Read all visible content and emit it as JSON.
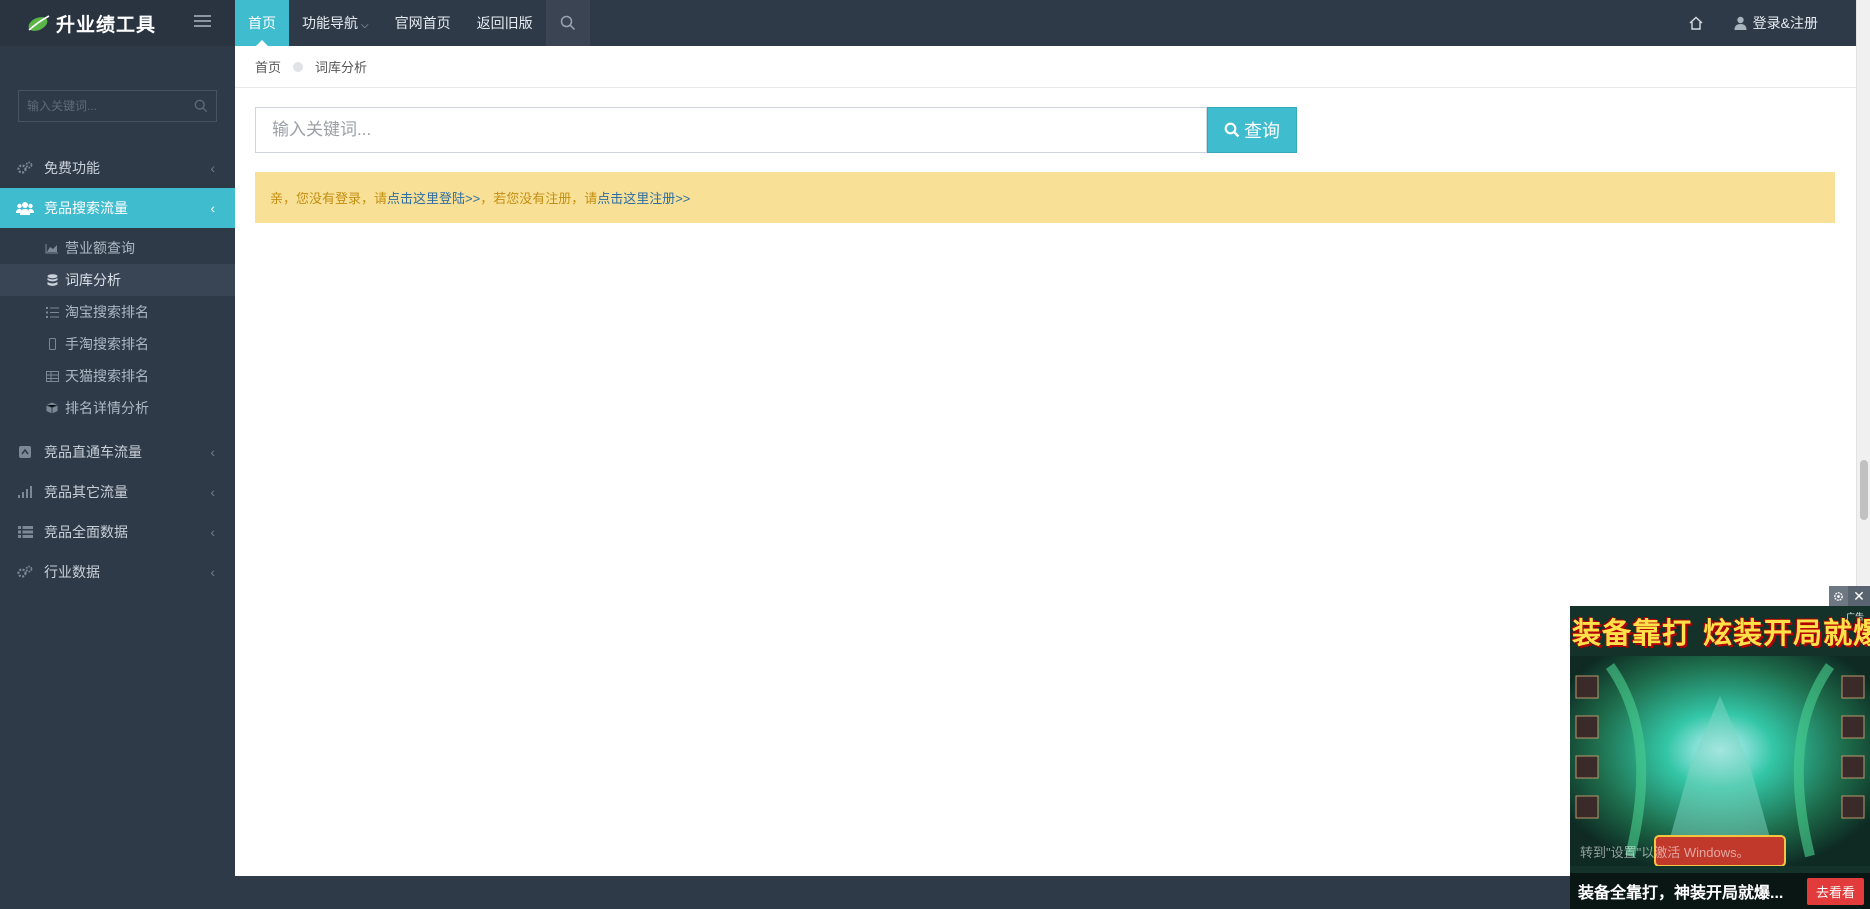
{
  "header": {
    "logo_text": "升业绩工具",
    "nav": [
      "首页",
      "功能导航",
      "官网首页",
      "返回旧版"
    ],
    "login_label": "登录&注册"
  },
  "sidebar": {
    "search_placeholder": "输入关键词...",
    "menu": [
      {
        "label": "免费功能",
        "icon": "gears-icon"
      },
      {
        "label": "竞品搜索流量",
        "icon": "users-icon"
      }
    ],
    "submenu": [
      {
        "label": "营业额查询",
        "icon": "area-chart-icon"
      },
      {
        "label": "词库分析",
        "icon": "database-icon"
      },
      {
        "label": "淘宝搜索排名",
        "icon": "list-ol-icon"
      },
      {
        "label": "手淘搜索排名",
        "icon": "mobile-icon"
      },
      {
        "label": "天猫搜索排名",
        "icon": "table-icon"
      },
      {
        "label": "排名详情分析",
        "icon": "cube-icon"
      }
    ],
    "menu_rest": [
      {
        "label": "竞品直通车流量",
        "icon": "car-icon"
      },
      {
        "label": "竞品其它流量",
        "icon": "signal-icon"
      },
      {
        "label": "竞品全面数据",
        "icon": "th-list-icon"
      },
      {
        "label": "行业数据",
        "icon": "cogs-icon"
      }
    ]
  },
  "breadcrumb": {
    "home": "首页",
    "current": "词库分析"
  },
  "search": {
    "placeholder": "输入关键词...",
    "button": "查询"
  },
  "notice": {
    "part1": "亲，您没有登录，请",
    "login_link": "点击这里登陆>>",
    "part2": "，若您没有注册，请",
    "register_link": "点击这里注册>>"
  },
  "ad": {
    "label": "广告",
    "headline": "装备靠打 炫装开局就爆",
    "watermark": "转到\"设置\"以激活 Windows。",
    "bottom_text": "装备全靠打，神装开局就爆...",
    "cta": "去看看"
  },
  "colors": {
    "accent": "#3fbccd",
    "sidebar": "#2f3a48",
    "notice_bg": "#f8e196"
  }
}
